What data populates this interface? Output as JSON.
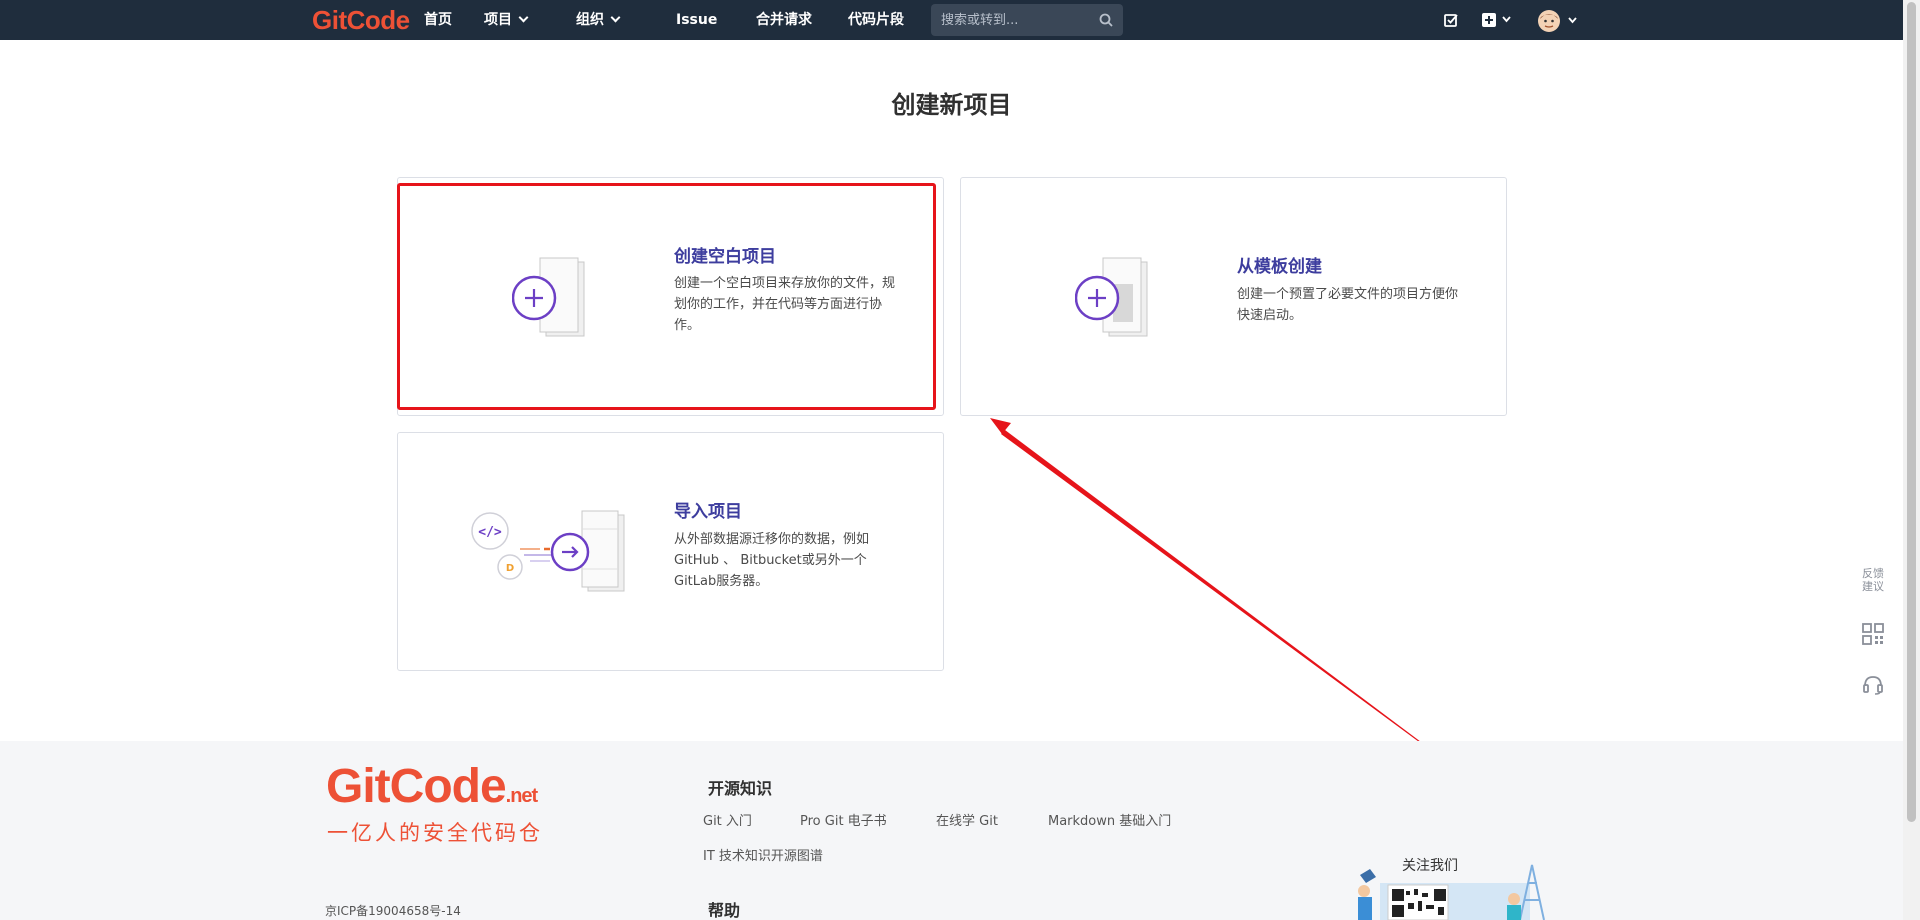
{
  "nav": {
    "logo": "GitCode",
    "items": [
      "首页",
      "项目",
      "组织",
      "Issue",
      "合并请求",
      "代码片段"
    ],
    "search_placeholder": "搜索或转到..."
  },
  "main": {
    "title": "创建新项目",
    "cards": [
      {
        "title": "创建空白项目",
        "desc": "创建一个空白项目来存放你的文件，规划你的工作，并在代码等方面进行协作。"
      },
      {
        "title": "从模板创建",
        "desc": "创建一个预置了必要文件的项目方便你快速启动。"
      },
      {
        "title": "导入项目",
        "desc": "从外部数据源迁移你的数据，例如 GitHub 、 Bitbucket或另外一个GitLab服务器。"
      }
    ]
  },
  "footer": {
    "logo_main": "GitCode",
    "logo_suffix": ".net",
    "slogan": "一亿人的安全代码仓",
    "icp": "京ICP备19004658号-14",
    "section1_title": "开源知识",
    "links": [
      "Git 入门",
      "Pro Git 电子书",
      "在线学 Git",
      "Markdown 基础入门",
      "IT 技术知识开源图谱"
    ],
    "section2_title": "帮助",
    "follow": "关注我们"
  },
  "float": {
    "feedback": "反馈建议"
  },
  "colors": {
    "nav_bg": "#1f2d3d",
    "brand": "#ed5136",
    "card_title": "#3d3d9e",
    "highlight": "#e6141a"
  }
}
